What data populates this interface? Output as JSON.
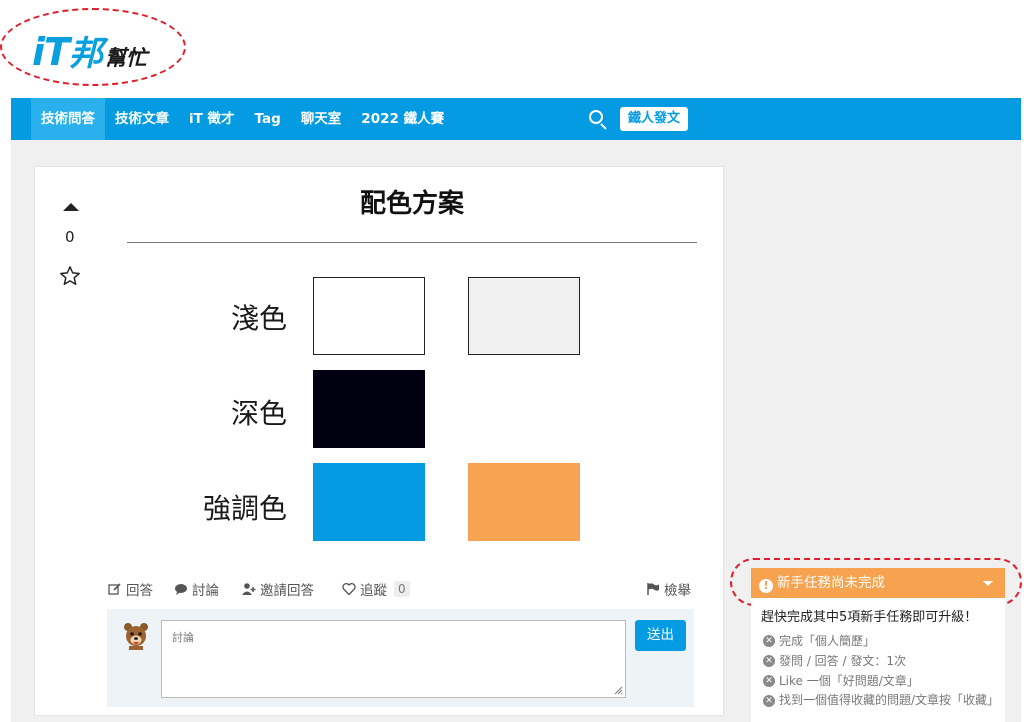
{
  "logo": {
    "it": "iT",
    "bang": "邦",
    "help": "幫忙"
  },
  "nav": {
    "items": [
      "技術問答",
      "技術文章",
      "iT 徵才",
      "Tag",
      "聊天室",
      "2022 鐵人賽"
    ],
    "post_label": "鐵人發文"
  },
  "post": {
    "vote_count": "0",
    "title": "配色方案",
    "colors": {
      "light_label": "淺色",
      "dark_label": "深色",
      "accent_label": "強調色",
      "light_1": "#ffffff",
      "light_2": "#f0f0f0",
      "dark_1": "#000011",
      "accent_1": "#049be2",
      "accent_2": "#f6a451"
    },
    "actions": {
      "answer": "回答",
      "discuss": "討論",
      "invite": "邀請回答",
      "follow": "追蹤",
      "follow_count": "0",
      "report": "檢舉"
    },
    "comment": {
      "placeholder": "討論",
      "send": "送出"
    }
  },
  "tasks": {
    "title": "新手任務尚未完成",
    "heading": "趕快完成其中5項新手任務即可升級！",
    "items": [
      "完成「個人簡歷」",
      "發問 / 回答 / 發文：1次",
      "Like 一個「好問題/文章」",
      "找到一個值得收藏的問題/文章按「收藏」"
    ]
  }
}
